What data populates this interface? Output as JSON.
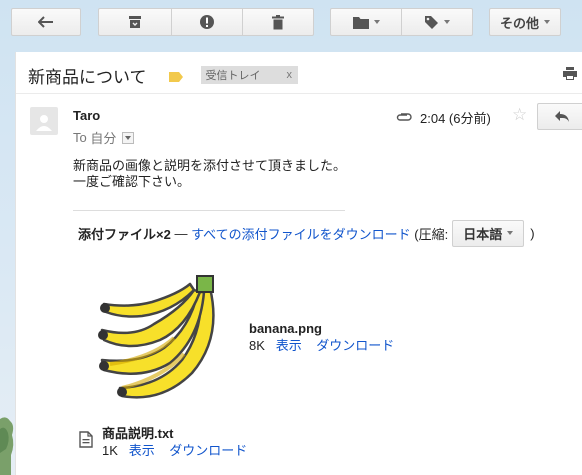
{
  "toolbar": {
    "more_label": "その他"
  },
  "message": {
    "subject": "新商品について",
    "label": "受信トレイ",
    "label_remove": "x",
    "sender": "Taro",
    "to_prefix": "To",
    "to_name": "自分",
    "time": "2:04 (6分前)",
    "body_line1": "新商品の画像と説明を添付させて頂きました。",
    "body_line2": "一度ご確認下さい。"
  },
  "attachments": {
    "count_label": "添付ファイル×2",
    "dash": "—",
    "download_all": "すべての添付ファイルをダウンロード",
    "compress_prefix": "(圧縮:",
    "language": "日本語",
    "compress_suffix": ")",
    "files": [
      {
        "name": "banana.png",
        "size": "8K",
        "view": "表示",
        "download": "ダウンロード"
      },
      {
        "name": "商品説明.txt",
        "size": "1K",
        "view": "表示",
        "download": "ダウンロード"
      }
    ]
  },
  "colors": {
    "link": "#1155cc",
    "label_marker": "#f2c94c",
    "banana": "#f7e02a"
  }
}
